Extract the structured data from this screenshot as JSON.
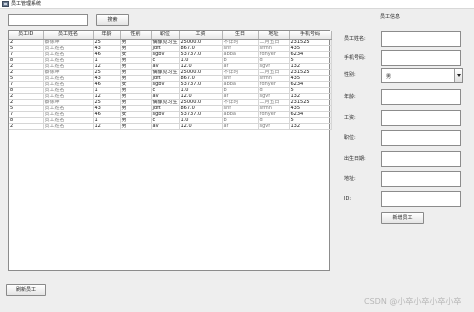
{
  "window": {
    "title": "员工管理系统"
  },
  "search": {
    "value": "",
    "button_label": "搜索"
  },
  "table": {
    "columns": [
      "员工ID",
      "员工姓名",
      "年龄",
      "性别",
      "职位",
      "工资",
      "生日",
      "地址",
      "手机号码"
    ],
    "rows": [
      [
        "2",
        "蔡徐坤",
        "25",
        "男",
        "偶像见习生",
        "25000.0",
        "不详时",
        "二月五日",
        "231525"
      ],
      [
        "5",
        "员工姓名",
        "43",
        "男",
        "jdft",
        "867.0",
        "shf",
        "sfmn",
        "435"
      ],
      [
        "7",
        "员工姓名",
        "46",
        "女",
        "sgbv",
        "53737.0",
        "abba",
        "rdhyer",
        "6234"
      ],
      [
        "8",
        "员工姓名",
        "1",
        "男",
        "c",
        "1.0",
        "b",
        "d",
        "5"
      ],
      [
        "2",
        "员工姓名",
        "12",
        "男",
        "av",
        "12.0",
        "af",
        "sgvf",
        "132"
      ],
      [
        "2",
        "蔡徐坤",
        "25",
        "男",
        "偶像见习生",
        "25000.0",
        "不详时",
        "二月五日",
        "231525"
      ],
      [
        "5",
        "员工姓名",
        "43",
        "男",
        "jdft",
        "867.0",
        "shf",
        "sfmn",
        "435"
      ],
      [
        "7",
        "员工姓名",
        "46",
        "女",
        "sgbv",
        "53737.0",
        "abba",
        "rdhyer",
        "6234"
      ],
      [
        "8",
        "员工姓名",
        "1",
        "男",
        "c",
        "1.0",
        "b",
        "d",
        "5"
      ],
      [
        "2",
        "员工姓名",
        "12",
        "男",
        "av",
        "12.0",
        "af",
        "sgvf",
        "132"
      ],
      [
        "2",
        "蔡徐坤",
        "25",
        "男",
        "偶像见习生",
        "25000.0",
        "不详时",
        "二月五日",
        "231525"
      ],
      [
        "5",
        "员工姓名",
        "43",
        "男",
        "jdft",
        "867.0",
        "shf",
        "sfmn",
        "435"
      ],
      [
        "7",
        "员工姓名",
        "46",
        "女",
        "sgbv",
        "53737.0",
        "abba",
        "rdhyer",
        "6234"
      ],
      [
        "8",
        "员工姓名",
        "1",
        "男",
        "c",
        "1.0",
        "b",
        "d",
        "5"
      ],
      [
        "2",
        "员工姓名",
        "12",
        "男",
        "av",
        "12.0",
        "af",
        "sgvf",
        "132"
      ]
    ]
  },
  "form": {
    "title": "员工信息",
    "name_label": "员工姓名:",
    "phone_label": "手机号码:",
    "gender_label": "性别:",
    "gender_value": "男",
    "age_label": "年龄:",
    "salary_label": "工资:",
    "position_label": "职位:",
    "birthday_label": "出生日期:",
    "address_label": "地址:",
    "id_label": "ID:",
    "add_button": "新增员工"
  },
  "bottom": {
    "refresh_button": "刷新员工"
  },
  "watermark": "CSDN @小卒小卒小卒小卒"
}
